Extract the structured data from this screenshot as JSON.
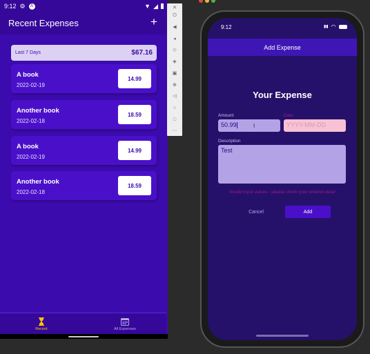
{
  "android": {
    "status": {
      "time": "9:12"
    },
    "header": {
      "title": "Recent Expenses",
      "add_label": "+"
    },
    "summary": {
      "period": "Last 7 Days",
      "total": "$67.16"
    },
    "expenses": [
      {
        "name": "A book",
        "date": "2022-02-19",
        "amount": "14.99"
      },
      {
        "name": "Another book",
        "date": "2022-02-18",
        "amount": "18.59"
      },
      {
        "name": "A book",
        "date": "2022-02-19",
        "amount": "14.99"
      },
      {
        "name": "Another book",
        "date": "2022-02-18",
        "amount": "18.59"
      }
    ],
    "tabs": [
      {
        "label": "Recent",
        "icon": "hourglass-icon",
        "active": true
      },
      {
        "label": "All Expenses",
        "icon": "calendar-icon",
        "active": false
      }
    ]
  },
  "ios": {
    "status": {
      "time": "9:12"
    },
    "header": {
      "title": "Add Expense"
    },
    "form_title": "Your Expense",
    "amount": {
      "label": "Amount",
      "value": "50.99"
    },
    "date": {
      "label": "Date",
      "placeholder": "YYYY-MM-DD"
    },
    "description": {
      "label": "Description",
      "value": "Test"
    },
    "error": "Invalid input values - please check your entered data!",
    "buttons": {
      "cancel": "Cancel",
      "add": "Add"
    }
  },
  "colors": {
    "android_primary": "#3c0bad",
    "ios_background": "#25116a",
    "accent": "#ffc107",
    "error": "#a3158d"
  }
}
